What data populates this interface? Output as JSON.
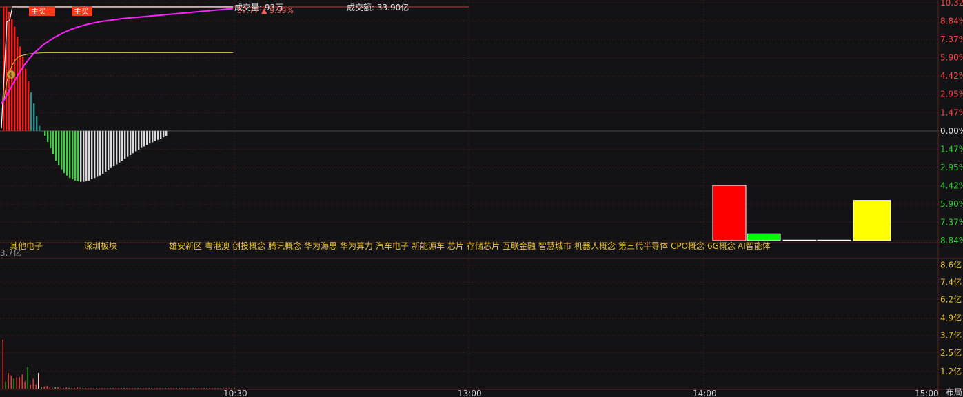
{
  "header": {
    "volume_label": "成交量: 93万",
    "amount_label": "成交额: 33.90亿",
    "price_info": "37.77 ▲ 9.99%"
  },
  "badges": [
    "主买",
    "主买"
  ],
  "sector_labels": [
    "其他电子",
    "深圳板块",
    "雄安新区",
    "粤港澳",
    "创投概念",
    "腾讯概念",
    "华为海思",
    "华为算力",
    "汽车电子",
    "新能源车",
    "芯片",
    "存储芯片",
    "互联金融",
    "智慧城市",
    "机器人概念",
    "第三代半导体",
    "CPO概念",
    "6G概念",
    "AI智能体"
  ],
  "volume_max_label": "3.7亿",
  "layout_button": "布局",
  "colors": {
    "up": "#ff2a2a",
    "down": "#33cc33",
    "grid": "#3a1a1a",
    "price_line": "#ffffff",
    "avg_line": "#e8c33a",
    "ma_line": "#ff22ff",
    "axis_up": "#ff4444",
    "axis_down": "#33cc33",
    "axis_neutral": "#dddddd",
    "volume_axis": "#e8c33a"
  },
  "chart_data": [
    {
      "type": "line",
      "name": "intraday-price-chart",
      "x_ticks": [
        "10:30",
        "13:00",
        "14:00",
        "15:00"
      ],
      "y_ticks_pct": [
        10.32,
        8.84,
        7.37,
        5.9,
        4.42,
        2.95,
        1.47,
        0.0,
        -1.47,
        -2.95,
        -4.42,
        -5.9,
        -7.37,
        -8.84
      ],
      "y_tick_labels": [
        "10.32%",
        "8.84%",
        "7.37%",
        "5.90%",
        "4.42%",
        "2.95%",
        "1.47%",
        "0.00%",
        "1.47%",
        "2.95%",
        "4.42%",
        "5.90%",
        "7.37%",
        "8.84%"
      ],
      "ylim_pct": [
        -8.84,
        10.32
      ],
      "series": [
        {
          "values_pct": [
            0.2,
            4.5,
            8.8,
            8.9,
            9.99,
            9.99,
            9.99,
            9.99,
            9.99,
            9.99,
            9.99,
            9.99,
            9.99,
            9.99,
            9.99,
            9.99,
            9.99,
            9.99,
            9.99,
            9.99,
            9.99,
            9.99,
            9.99,
            9.99,
            9.99,
            9.99,
            9.99,
            9.99,
            9.99,
            9.99,
            9.99,
            9.99,
            9.99,
            9.99,
            9.99,
            9.99,
            9.99,
            9.99,
            9.99,
            9.99,
            9.99,
            9.99,
            9.99,
            9.99,
            9.99,
            9.99,
            9.99,
            9.99,
            9.99,
            9.99,
            9.99,
            9.99,
            9.99,
            9.99,
            9.99,
            9.99,
            9.99,
            9.99,
            9.99,
            9.99,
            9.99,
            9.99,
            9.99,
            9.99,
            9.99,
            9.99,
            9.99,
            9.99,
            9.99,
            9.99,
            9.99,
            9.99,
            9.99,
            9.99,
            9.99,
            9.99,
            9.99,
            9.99,
            9.99,
            9.99,
            9.99,
            9.99,
            9.99,
            9.99,
            9.99
          ]
        },
        {
          "values_pct": [
            2.2,
            2.6,
            4.0,
            4.8,
            5.3,
            5.7,
            5.95,
            6.05,
            6.1,
            6.15,
            6.2,
            6.22,
            6.25,
            6.27,
            6.28,
            6.3,
            6.3,
            6.3,
            6.3,
            6.3,
            6.3,
            6.3,
            6.3,
            6.3,
            6.3,
            6.3,
            6.3,
            6.3,
            6.3,
            6.3,
            6.3,
            6.3,
            6.3,
            6.3,
            6.3,
            6.3,
            6.3,
            6.3,
            6.3,
            6.3,
            6.3,
            6.3,
            6.3,
            6.3,
            6.3,
            6.3,
            6.3,
            6.3,
            6.3,
            6.3,
            6.3,
            6.3,
            6.3,
            6.3,
            6.3,
            6.3,
            6.3,
            6.3,
            6.3,
            6.3,
            6.3,
            6.3,
            6.3,
            6.3,
            6.3,
            6.3,
            6.3,
            6.3,
            6.3,
            6.3,
            6.3,
            6.3,
            6.3,
            6.3,
            6.3,
            6.3,
            6.3,
            6.3,
            6.3,
            6.3,
            6.3,
            6.3,
            6.3,
            6.3,
            6.3
          ]
        },
        {
          "values_pct": [
            2.2,
            2.5,
            2.9,
            3.3,
            3.7,
            4.1,
            4.5,
            4.85,
            5.2,
            5.5,
            5.8,
            6.05,
            6.3,
            6.5,
            6.7,
            6.9,
            7.05,
            7.2,
            7.35,
            7.5,
            7.62,
            7.74,
            7.85,
            7.95,
            8.05,
            8.15,
            8.23,
            8.31,
            8.38,
            8.45,
            8.51,
            8.57,
            8.62,
            8.67,
            8.72,
            8.76,
            8.8,
            8.84,
            8.87,
            8.9,
            8.93,
            8.96,
            8.99,
            9.02,
            9.05,
            9.07,
            9.09,
            9.11,
            9.13,
            9.15,
            9.17,
            9.19,
            9.21,
            9.23,
            9.25,
            9.27,
            9.29,
            9.31,
            9.33,
            9.35,
            9.37,
            9.39,
            9.41,
            9.43,
            9.45,
            9.47,
            9.49,
            9.51,
            9.53,
            9.55,
            9.57,
            9.59,
            9.61,
            9.63,
            9.65,
            9.67,
            9.69,
            9.71,
            9.73,
            9.75,
            9.77,
            9.79,
            9.81,
            9.83,
            9.85
          ]
        }
      ],
      "flow_bars_pct": [
        10.0,
        10.0,
        9.6,
        9.0,
        8.4,
        7.6,
        6.8,
        6.0,
        5.0,
        4.0,
        3.1,
        2.2,
        1.2,
        0.4,
        0,
        -0.4,
        -0.9,
        -1.4,
        -1.9,
        -2.4,
        -2.8,
        -3.1,
        -3.4,
        -3.6,
        -3.8,
        -3.9,
        -4.0,
        -4.05,
        -4.1,
        -4.1,
        -4.05,
        -4.0,
        -3.9,
        -3.8,
        -3.7,
        -3.6,
        -3.45,
        -3.3,
        -3.15,
        -3.0,
        -2.85,
        -2.7,
        -2.55,
        -2.4,
        -2.25,
        -2.1,
        -1.95,
        -1.8,
        -1.65,
        -1.5,
        -1.38,
        -1.26,
        -1.14,
        -1.02,
        -0.92,
        -0.82,
        -0.72,
        -0.62,
        -0.52,
        -0.42
      ],
      "side_bars_pct": [
        -4.4,
        -8.3,
        -8.8,
        -8.8,
        -5.6
      ],
      "side_bar_colors": [
        "#ff0000",
        "#00ff00",
        "#1aa3a3",
        "#b21616",
        "#ffff00"
      ]
    },
    {
      "type": "bar",
      "name": "volume-chart",
      "y_ticks": [
        8.6,
        7.4,
        6.2,
        4.9,
        3.7,
        2.5,
        1.2
      ],
      "y_tick_labels": [
        "8.6亿",
        "7.4亿",
        "6.2亿",
        "4.9亿",
        "3.7亿",
        "2.5亿",
        "1.2亿"
      ],
      "ylim": [
        0,
        9.0
      ],
      "values": [
        3.4,
        0.5,
        1.1,
        0.9,
        0.7,
        0.8,
        0.8,
        1.0,
        0.5,
        1.5,
        0.3,
        0.7,
        0.3,
        1.0,
        0.1,
        0.15,
        0.2,
        0.1,
        0.05,
        0.1,
        0.1,
        0.05,
        0.05,
        0.1,
        0.05,
        0.05,
        0.05,
        0.1,
        0.04,
        0.04,
        0.04,
        0.04,
        0.04,
        0.04,
        0.04,
        0.04,
        0.04,
        0.04,
        0.04,
        0.04,
        0.04,
        0.04,
        0.04,
        0.04,
        0.04,
        0.04,
        0.04,
        0.04,
        0.04,
        0.04,
        0.04,
        0.04,
        0.04,
        0.04,
        0.04,
        0.04,
        0.04,
        0.04,
        0.04,
        0.04,
        0.04,
        0.04,
        0.04,
        0.04,
        0.04,
        0.04,
        0.04,
        0.04,
        0.04,
        0.04,
        0.04,
        0.04,
        0.04,
        0.04,
        0.04,
        0.04,
        0.04,
        0.04,
        0.04,
        0.04,
        0.04,
        0.04,
        0.04,
        0.04,
        0.04
      ],
      "value_colors_up": [
        true,
        false,
        true,
        true,
        false,
        true,
        true,
        true,
        true,
        false,
        true,
        true,
        true,
        true,
        false,
        true,
        true,
        true,
        true,
        false,
        true,
        true,
        true,
        true,
        false,
        true,
        true,
        true,
        true,
        false,
        true,
        true,
        true,
        true,
        false,
        true,
        true,
        true,
        true,
        false,
        true,
        true,
        true,
        true,
        false,
        true,
        true,
        true,
        true,
        false,
        true,
        true,
        true,
        true,
        false,
        true,
        true,
        true,
        true,
        false,
        true,
        true,
        true,
        true,
        false,
        true,
        true,
        true,
        true,
        false,
        true,
        true,
        true,
        true,
        false,
        true,
        true,
        true,
        true,
        false,
        true,
        true,
        true,
        true,
        false
      ]
    }
  ]
}
